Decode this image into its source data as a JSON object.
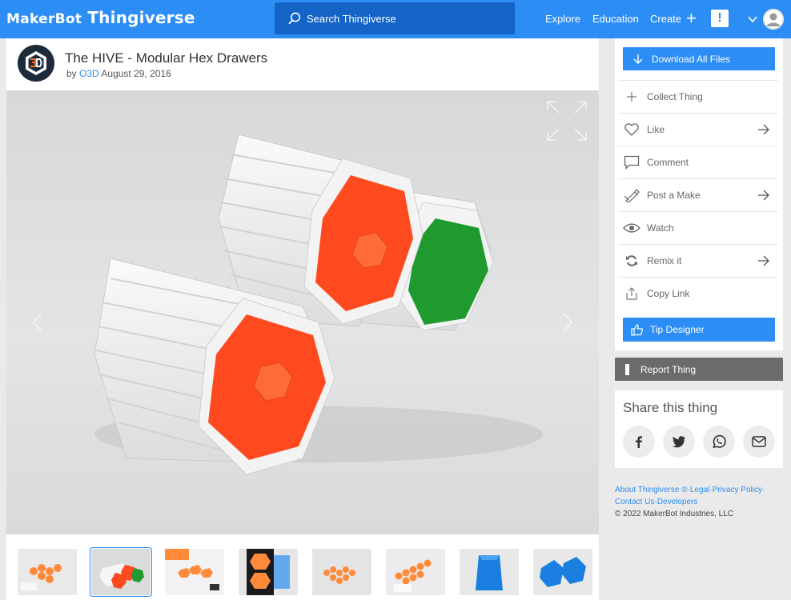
{
  "topbar": {
    "brand_prefix": "MakerBot",
    "brand_name": "Thingiverse",
    "search_placeholder": "Search Thingiverse",
    "nav": {
      "explore": "Explore",
      "education": "Education",
      "create": "Create"
    },
    "alert_label": "!"
  },
  "thing": {
    "title": "The HIVE - Modular Hex Drawers",
    "by_prefix": "by",
    "author": "O3D",
    "date": "August 29, 2016",
    "drawer_colors": [
      "#ff4a1f",
      "#1f9a2e"
    ]
  },
  "sidebar": {
    "download_label": "Download All Files",
    "actions": [
      {
        "label": "Collect Thing",
        "icon": "plus-icon",
        "has_arrow": false
      },
      {
        "label": "Like",
        "icon": "heart-icon",
        "has_arrow": true
      },
      {
        "label": "Comment",
        "icon": "comment-icon",
        "has_arrow": false
      },
      {
        "label": "Post a Make",
        "icon": "make-icon",
        "has_arrow": true
      },
      {
        "label": "Watch",
        "icon": "eye-icon",
        "has_arrow": false
      },
      {
        "label": "Remix it",
        "icon": "remix-icon",
        "has_arrow": true
      },
      {
        "label": "Copy Link",
        "icon": "share-out-icon",
        "has_arrow": false
      }
    ],
    "tip_label": "Tip Designer",
    "report_label": "Report Thing",
    "share_title": "Share this thing",
    "share_icons": [
      "facebook-icon",
      "twitter-icon",
      "whatsapp-icon",
      "email-icon"
    ],
    "footer": {
      "about": "About Thingiverse ®",
      "legal": "Legal",
      "privacy": "Privacy Policy",
      "contact": "Contact Us",
      "developers": "Developers",
      "copyright": "©  2022 MakerBot Industries, LLC"
    }
  },
  "colors": {
    "brand_blue": "#2c8ef4",
    "search_blue": "#1364c6",
    "report_gray": "#6b6b6b"
  }
}
